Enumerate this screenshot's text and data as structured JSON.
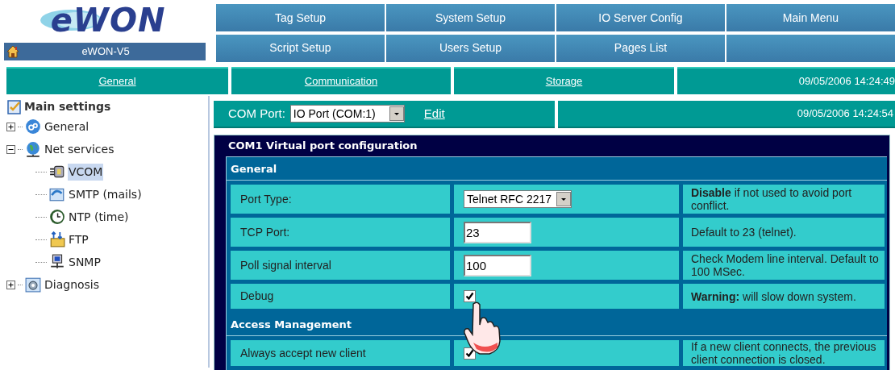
{
  "logo": {
    "text": "eWON"
  },
  "device_bar": {
    "name": "eWON-V5"
  },
  "top_menu": [
    {
      "label": "Tag Setup"
    },
    {
      "label": "System Setup"
    },
    {
      "label": "IO Server Config"
    },
    {
      "label": "Main Menu"
    },
    {
      "label": "Script Setup"
    },
    {
      "label": "Users Setup"
    },
    {
      "label": "Pages List"
    }
  ],
  "tabs": [
    {
      "label": "General",
      "selected": false
    },
    {
      "label": "Communication",
      "selected": false
    },
    {
      "label": "Storage",
      "selected": false
    }
  ],
  "tab_bar_time": "09/05/2006 14:24:49",
  "tree": {
    "title": "Main settings",
    "items": [
      {
        "label": "General",
        "expanded": false,
        "selected": false
      },
      {
        "label": "Net services",
        "expanded": true,
        "selected": false,
        "children": [
          {
            "label": "VCOM",
            "selected": true
          },
          {
            "label": "SMTP (mails)",
            "selected": false
          },
          {
            "label": "NTP (time)",
            "selected": false
          },
          {
            "label": "FTP",
            "selected": false
          },
          {
            "label": "SNMP",
            "selected": false
          }
        ]
      },
      {
        "label": "Diagnosis",
        "expanded": false,
        "selected": false
      }
    ]
  },
  "com_bar": {
    "label": "COM Port:",
    "value": "IO Port (COM:1)",
    "link": "Edit",
    "time": "09/05/2006 14:24:54"
  },
  "panel": {
    "title": "COM1 Virtual port configuration",
    "sections": [
      {
        "title": "General",
        "rows": [
          {
            "label": "Port Type:",
            "kind": "select",
            "value": "Telnet RFC 2217",
            "help": "**Disable** if not used to avoid port conflict."
          },
          {
            "label": "TCP Port:",
            "kind": "text",
            "value": "23",
            "help": "Default to 23 (telnet)."
          },
          {
            "label": "Poll signal interval",
            "kind": "text",
            "value": "100",
            "help": "Check Modem line interval. Default to 100 MSec."
          },
          {
            "label": "Debug",
            "kind": "checkbox",
            "checked": true,
            "help": "**Warning:** will slow down system."
          }
        ]
      },
      {
        "title": "Access Management",
        "rows": [
          {
            "label": "Always accept new client",
            "kind": "checkbox",
            "checked": true,
            "help": "If a new client connects, the previous client connection is closed."
          }
        ]
      }
    ]
  }
}
